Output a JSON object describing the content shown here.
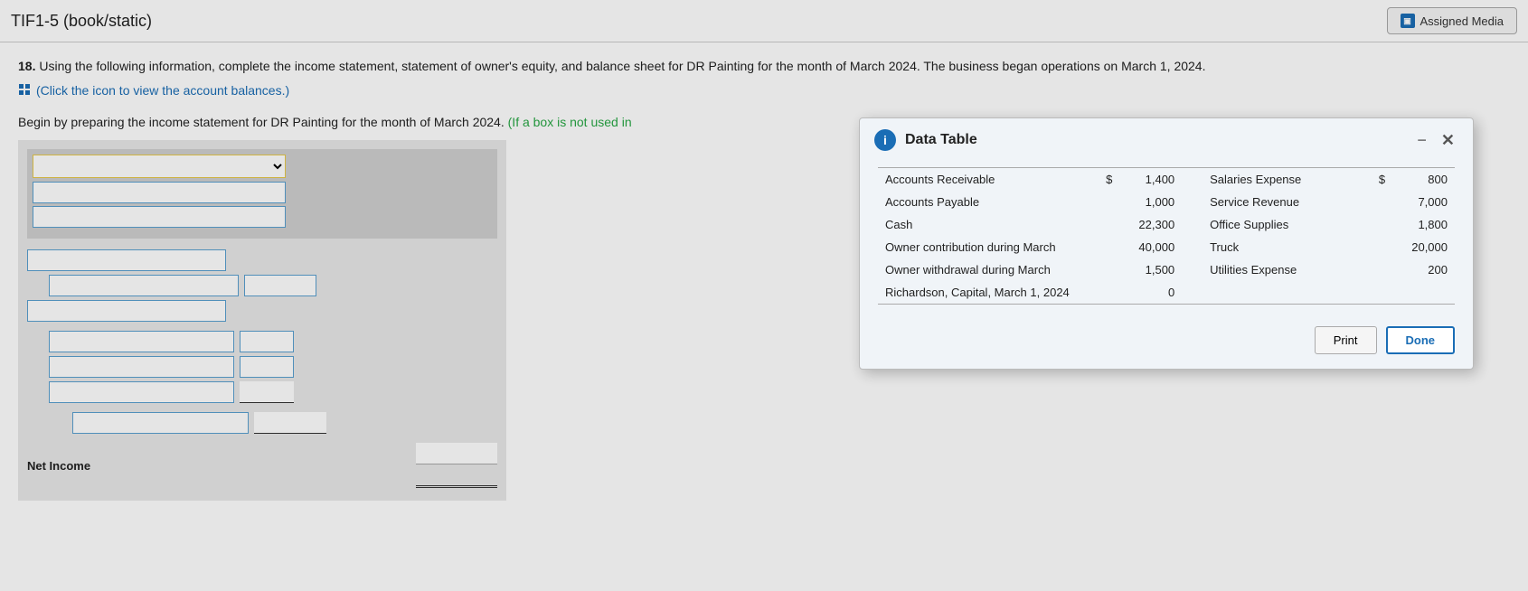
{
  "header": {
    "title": "TIF1-5 (book/static)",
    "assigned_media_label": "Assigned Media"
  },
  "question": {
    "number": "18.",
    "text": "Using the following information, complete the income statement, statement of owner's equity, and balance sheet for DR Painting for the month of March 2024. The business began operations on March 1, 2024.",
    "icon_link_text": "(Click the icon to view the account balances.)"
  },
  "instruction": {
    "text": "Begin by preparing the income statement for DR Painting for the month of March 2024.",
    "highlight": "(If a box is not used in"
  },
  "form": {
    "dropdown_placeholder": "",
    "net_income_label": "Net Income"
  },
  "modal": {
    "title": "Data Table",
    "info_icon": "i",
    "table": {
      "rows": [
        {
          "left_label": "Accounts Receivable",
          "left_dollar": "$",
          "left_amount": "1,400",
          "right_label": "Salaries Expense",
          "right_dollar": "$",
          "right_amount": "800"
        },
        {
          "left_label": "Accounts Payable",
          "left_dollar": "",
          "left_amount": "1,000",
          "right_label": "Service Revenue",
          "right_dollar": "",
          "right_amount": "7,000"
        },
        {
          "left_label": "Cash",
          "left_dollar": "",
          "left_amount": "22,300",
          "right_label": "Office Supplies",
          "right_dollar": "",
          "right_amount": "1,800"
        },
        {
          "left_label": "Owner contribution during March",
          "left_dollar": "",
          "left_amount": "40,000",
          "right_label": "Truck",
          "right_dollar": "",
          "right_amount": "20,000"
        },
        {
          "left_label": "Owner withdrawal during March",
          "left_dollar": "",
          "left_amount": "1,500",
          "right_label": "Utilities Expense",
          "right_dollar": "",
          "right_amount": "200"
        },
        {
          "left_label": "Richardson, Capital, March 1, 2024",
          "left_dollar": "",
          "left_amount": "0",
          "right_label": "",
          "right_dollar": "",
          "right_amount": ""
        }
      ]
    },
    "print_label": "Print",
    "done_label": "Done"
  }
}
